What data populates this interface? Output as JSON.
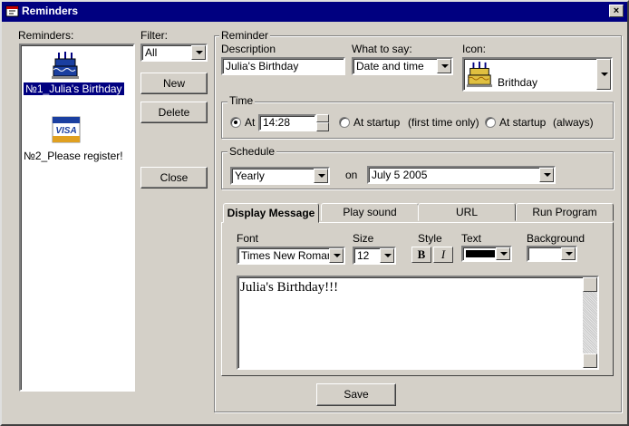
{
  "window": {
    "title": "Reminders",
    "close": "×"
  },
  "left": {
    "reminders_label": "Reminders:",
    "items": [
      {
        "label": "№1_Julia's Birthday",
        "selected": true
      },
      {
        "label": "№2_Please register!",
        "selected": false
      }
    ],
    "filter_label": "Filter:",
    "filter_value": "All",
    "new_label": "New",
    "delete_label": "Delete",
    "close_label": "Close"
  },
  "reminder": {
    "group_title": "Reminder",
    "description_label": "Description",
    "description_value": "Julia's Birthday",
    "what_label": "What to say:",
    "what_value": "Date and time",
    "icon_label": "Icon:",
    "icon_value": "Brithday",
    "icon_card_text": "VISA"
  },
  "time": {
    "group_title": "Time",
    "at_label": "At",
    "at_value": "14:28",
    "startup1_label": "At startup",
    "startup1_note": "(first time only)",
    "startup2_label": "At startup",
    "startup2_note": "(always)"
  },
  "schedule": {
    "group_title": "Schedule",
    "period_value": "Yearly",
    "on_label": "on",
    "date_value": "July 5 2005"
  },
  "tabs": [
    "Display Message",
    "Play sound",
    "URL",
    "Run Program"
  ],
  "display": {
    "font_label": "Font",
    "font_value": "Times New Roman",
    "size_label": "Size",
    "size_value": "12",
    "style_label": "Style",
    "bold": "B",
    "italic": "I",
    "text_label": "Text",
    "background_label": "Background",
    "message": "Julia's Birthday!!!"
  },
  "save_label": "Save",
  "colors": {
    "titlebar": "#000080",
    "selection": "#000080",
    "face": "#d4d0c8"
  }
}
